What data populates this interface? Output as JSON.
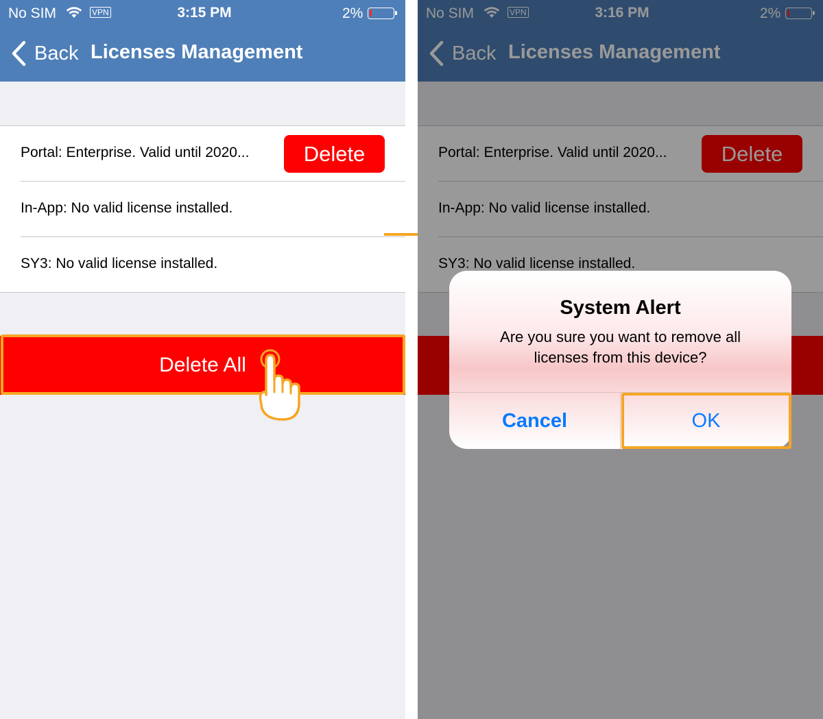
{
  "colors": {
    "navbar": "#4f7fb8",
    "delete_red": "#ff0000",
    "highlight": "#f5a623",
    "alert_button_blue": "#0a7aff",
    "background": "#efeff4"
  },
  "left_screen": {
    "status": {
      "carrier": "No SIM",
      "vpn": "VPN",
      "time": "3:15 PM",
      "battery": "2%"
    },
    "nav": {
      "back_label": "Back",
      "title": "Licenses Management"
    },
    "licenses": [
      {
        "text": "Portal: Enterprise. Valid until 2020...",
        "action": "Delete"
      },
      {
        "text": "In-App: No valid license installed."
      },
      {
        "text": "SY3: No valid license installed."
      }
    ],
    "delete_all_label": "Delete All"
  },
  "right_screen": {
    "status": {
      "carrier": "No SIM",
      "vpn": "VPN",
      "time": "3:16 PM",
      "battery": "2%"
    },
    "nav": {
      "back_label": "Back",
      "title": "Licenses Management"
    },
    "licenses": [
      {
        "text": "Portal: Enterprise. Valid until 2020...",
        "action": "Delete"
      },
      {
        "text": "In-App: No valid license installed."
      },
      {
        "text": "SY3: No valid license installed."
      }
    ],
    "alert": {
      "title": "System Alert",
      "message": "Are you sure you want to remove all licenses from this device?",
      "cancel_label": "Cancel",
      "ok_label": "OK"
    }
  }
}
